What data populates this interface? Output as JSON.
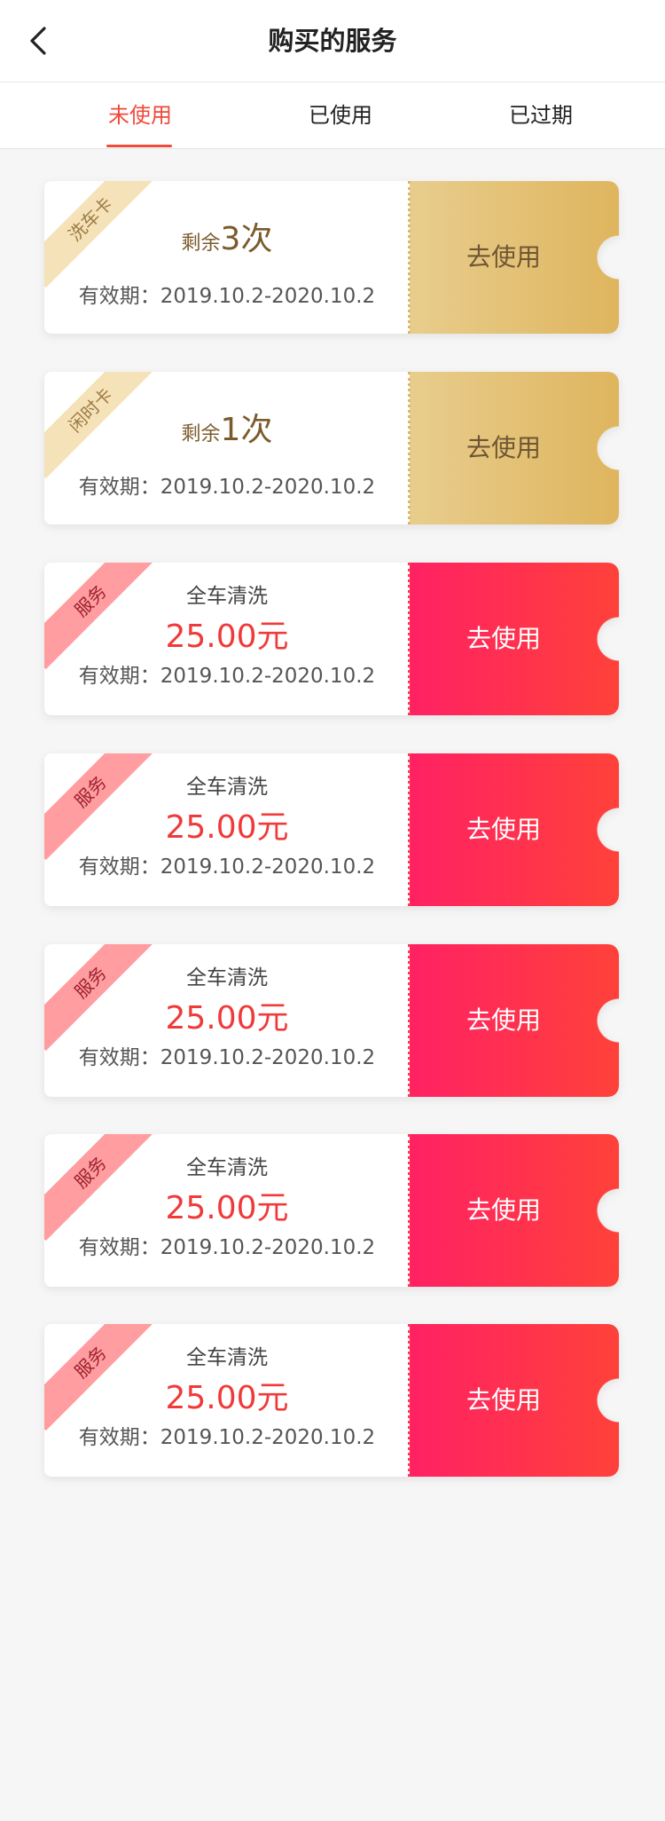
{
  "header": {
    "title": "购买的服务"
  },
  "tabs": [
    {
      "label": "未使用"
    },
    {
      "label": "已使用"
    },
    {
      "label": "已过期"
    }
  ],
  "cards": [
    {
      "type": "gold",
      "ribbon": "洗车卡",
      "remain_prefix": "剩余",
      "remain_count": "3次",
      "validity": "有效期：2019.10.2-2020.10.2",
      "button": "去使用"
    },
    {
      "type": "gold",
      "ribbon": "闲时卡",
      "remain_prefix": "剩余",
      "remain_count": "1次",
      "validity": "有效期：2019.10.2-2020.10.2",
      "button": "去使用"
    },
    {
      "type": "red",
      "ribbon": "服务",
      "service": "全车清洗",
      "price": "25.00元",
      "validity": "有效期：2019.10.2-2020.10.2",
      "button": "去使用"
    },
    {
      "type": "red",
      "ribbon": "服务",
      "service": "全车清洗",
      "price": "25.00元",
      "validity": "有效期：2019.10.2-2020.10.2",
      "button": "去使用"
    },
    {
      "type": "red",
      "ribbon": "服务",
      "service": "全车清洗",
      "price": "25.00元",
      "validity": "有效期：2019.10.2-2020.10.2",
      "button": "去使用"
    },
    {
      "type": "red",
      "ribbon": "服务",
      "service": "全车清洗",
      "price": "25.00元",
      "validity": "有效期：2019.10.2-2020.10.2",
      "button": "去使用"
    },
    {
      "type": "red",
      "ribbon": "服务",
      "service": "全车清洗",
      "price": "25.00元",
      "validity": "有效期：2019.10.2-2020.10.2",
      "button": "去使用"
    }
  ],
  "colors": {
    "accent": "#f04a3a",
    "gold_start": "#e8cd8d",
    "gold_end": "#dfb55e",
    "red_start": "#ff2163",
    "red_end": "#ff413a"
  },
  "icons": {
    "back": "chevron-left-icon"
  }
}
